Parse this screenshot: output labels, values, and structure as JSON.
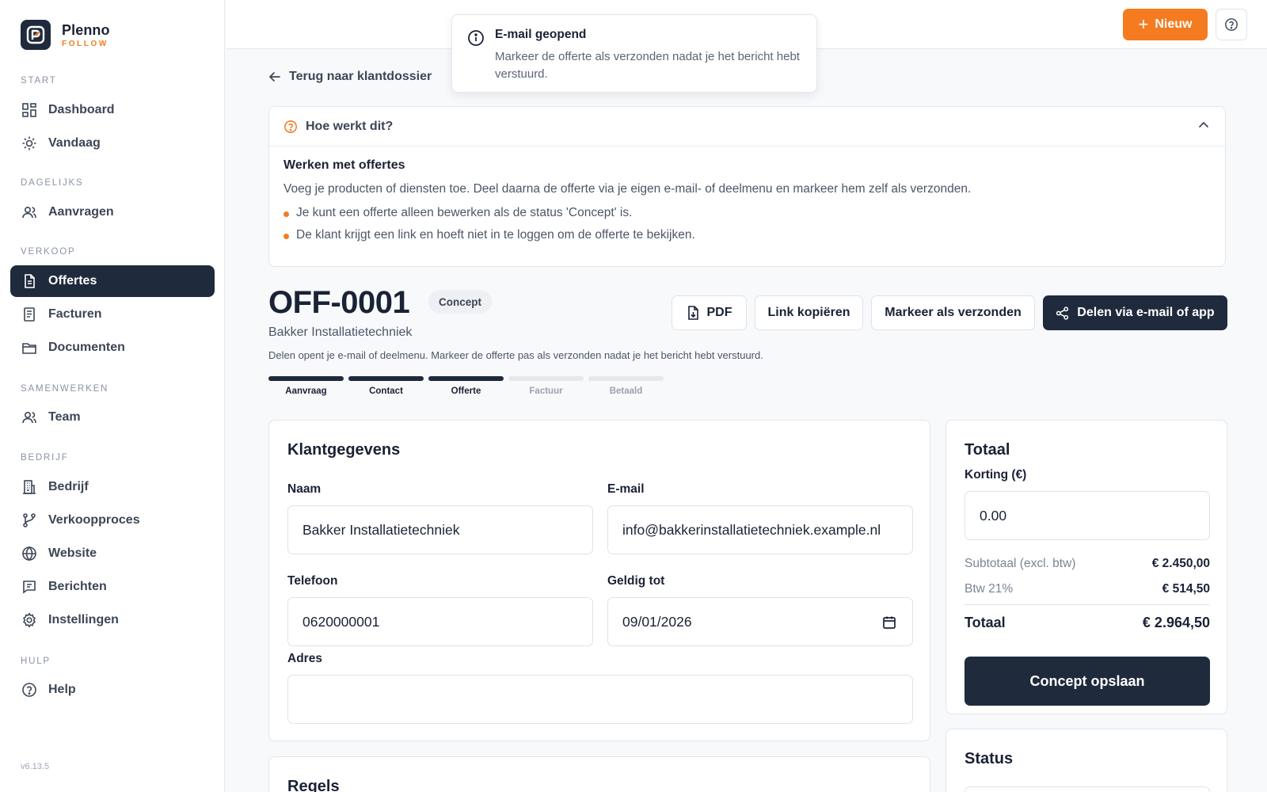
{
  "brand": {
    "name": "Plenno",
    "sub": "FOLLOW"
  },
  "sidebar": {
    "sections": [
      {
        "label": "START"
      },
      {
        "label": "DAGELIJKS"
      },
      {
        "label": "VERKOOP"
      },
      {
        "label": "SAMENWERKEN"
      },
      {
        "label": "BEDRIJF"
      },
      {
        "label": "HULP"
      }
    ],
    "items": [
      {
        "label": "Dashboard",
        "icon": "dashboard-icon"
      },
      {
        "label": "Vandaag",
        "icon": "sun-icon"
      },
      {
        "label": "Aanvragen",
        "icon": "users-icon"
      },
      {
        "label": "Offertes",
        "icon": "document-icon",
        "active": true
      },
      {
        "label": "Facturen",
        "icon": "invoice-icon"
      },
      {
        "label": "Documenten",
        "icon": "folder-icon"
      },
      {
        "label": "Team",
        "icon": "team-icon"
      },
      {
        "label": "Bedrijf",
        "icon": "building-icon"
      },
      {
        "label": "Verkoopproces",
        "icon": "branch-icon"
      },
      {
        "label": "Website",
        "icon": "globe-icon"
      },
      {
        "label": "Berichten",
        "icon": "message-icon"
      },
      {
        "label": "Instellingen",
        "icon": "gear-icon"
      },
      {
        "label": "Help",
        "icon": "help-icon"
      }
    ],
    "version": "v6.13.5"
  },
  "topbar": {
    "new_label": "Nieuw"
  },
  "toast": {
    "title": "E-mail geopend",
    "message": "Markeer de offerte als verzonden nadat je het bericht hebt verstuurd."
  },
  "main": {
    "back_label": "Terug naar klantdossier",
    "howto": {
      "header": "Hoe werkt dit?",
      "title": "Werken met offertes",
      "text": "Voeg je producten of diensten toe. Deel daarna de offerte via je eigen e-mail- of deelmenu en markeer hem zelf als verzonden.",
      "bullets": [
        "Je kunt een offerte alleen bewerken als de status 'Concept' is.",
        "De klant krijgt een link en hoeft niet in te loggen om de offerte te bekijken."
      ]
    },
    "quote": {
      "number": "OFF-0001",
      "status": "Concept",
      "client": "Bakker Installatietechniek",
      "hint": "Delen opent je e-mail of deelmenu. Markeer de offerte pas als verzonden nadat je het bericht hebt verstuurd."
    },
    "actions": {
      "pdf": "PDF",
      "copy_link": "Link kopiëren",
      "mark_sent": "Markeer als verzonden",
      "share": "Delen via e-mail of app"
    },
    "progress": {
      "steps": [
        {
          "label": "Aanvraag",
          "done": true
        },
        {
          "label": "Contact",
          "done": true
        },
        {
          "label": "Offerte",
          "done": true
        },
        {
          "label": "Factuur",
          "done": false
        },
        {
          "label": "Betaald",
          "done": false
        }
      ]
    },
    "customer": {
      "title": "Klantgegevens",
      "name_label": "Naam",
      "name_value": "Bakker Installatietechniek",
      "email_label": "E-mail",
      "email_value": "info@bakkerinstallatietechniek.example.nl",
      "phone_label": "Telefoon",
      "phone_value": "0620000001",
      "valid_label": "Geldig tot",
      "valid_value": "09/01/2026",
      "address_label": "Adres",
      "address_value": ""
    },
    "lines": {
      "title": "Regels"
    },
    "totals": {
      "title": "Totaal",
      "discount_label": "Korting (€)",
      "discount_value": "0.00",
      "subtotal_label": "Subtotaal (excl. btw)",
      "subtotal_value": "€ 2.450,00",
      "vat_label": "Btw 21%",
      "vat_value": "€ 514,50",
      "total_label": "Totaal",
      "total_value": "€ 2.964,50",
      "save_label": "Concept opslaan"
    },
    "status_card": {
      "title": "Status"
    }
  },
  "colors": {
    "accent": "#f47b20",
    "navy": "#1f2a3c"
  }
}
